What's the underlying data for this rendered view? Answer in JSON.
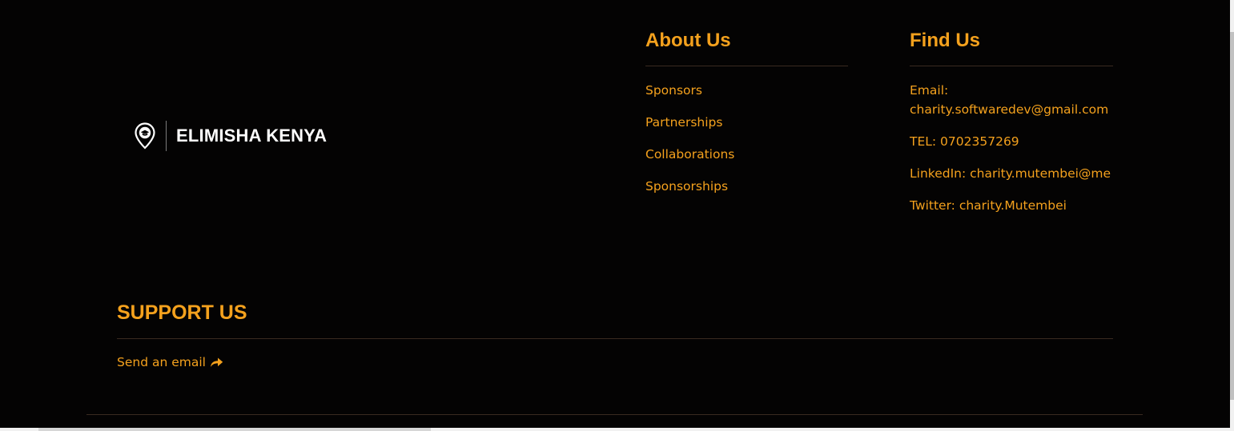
{
  "brand": {
    "name": "ELIMISHA KENYA",
    "icon": "map-pin-graduation-cap-icon"
  },
  "about": {
    "heading": "About Us",
    "links": [
      "Sponsors",
      "Partnerships",
      "Collaborations",
      "Sponsorships"
    ]
  },
  "find": {
    "heading": "Find Us",
    "email_label": "Email:",
    "email_value": "charity.softwaredev@gmail.com",
    "tel": "TEL: 0702357269",
    "linkedin": "LinkedIn: charity.mutembei@me",
    "twitter": "Twitter: charity.Mutembei"
  },
  "support": {
    "heading": "SUPPORT US",
    "link_label": "Send an email",
    "link_icon": "share-arrow-icon"
  },
  "colors": {
    "background": "#040303",
    "accent": "#f4a11d",
    "brand_text": "#ffffff",
    "divider": "#3a2a20"
  }
}
